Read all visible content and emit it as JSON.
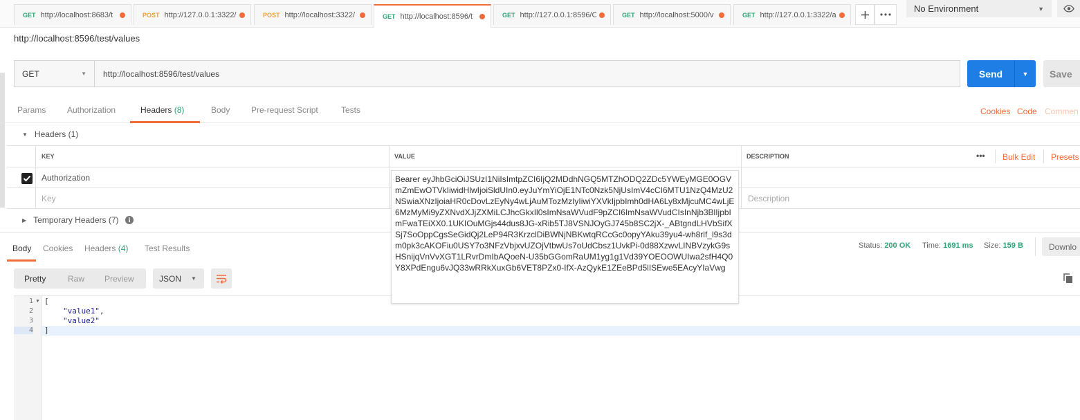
{
  "tabs": [
    {
      "method": "GET",
      "url": "http://localhost:8683/t"
    },
    {
      "method": "POST",
      "url": "http://127.0.0.1:3322/"
    },
    {
      "method": "POST",
      "url": "http://localhost:3322/"
    },
    {
      "method": "GET",
      "url": "http://localhost:8596/t"
    },
    {
      "method": "GET",
      "url": "http://127.0.0.1:8596/C"
    },
    {
      "method": "GET",
      "url": "http://localhost:5000/v"
    },
    {
      "method": "GET",
      "url": "http://127.0.0.1:3322/a"
    }
  ],
  "environment": "No Environment",
  "request": {
    "title": "http://localhost:8596/test/values",
    "method": "GET",
    "url": "http://localhost:8596/test/values",
    "send_label": "Send",
    "save_label": "Save"
  },
  "request_tabs": {
    "params": "Params",
    "authorization": "Authorization",
    "headers": "Headers",
    "headers_count": "(8)",
    "body": "Body",
    "prerequest": "Pre-request Script",
    "tests": "Tests",
    "cookies": "Cookies",
    "code": "Code",
    "comments": "Commen"
  },
  "headers_section": {
    "title": "Headers",
    "count": "(1)",
    "col_key": "KEY",
    "col_value": "VALUE",
    "col_description": "DESCRIPTION",
    "more": "•••",
    "bulk_edit": "Bulk Edit",
    "presets": "Presets",
    "row_key": "Authorization",
    "key_placeholder": "Key",
    "description_placeholder": "Description",
    "token": "Bearer eyJhbGciOiJSUzI1NiIsImtpZCI6IjQ2MDdhNGQ5MTZhODQ2ZDc5YWEyMGE0OGVmZmEwOTVkIiwidHlwIjoiSldUIn0.eyJuYmYiOjE1NTc0Nzk5NjUsImV4cCI6MTU1NzQ4MzU2NSwiaXNzIjoiaHR0cDovLzEyNy4wLjAuMTozMzIyIiwiYXVkIjpbImh0dHA6Ly8xMjcuMC4wLjE6MzMyMi9yZXNvdXJjZXMiLCJhcGkxIl0sImNsaWVudF9pZCI6ImNsaWVudCIsInNjb3BlIjpbImFwaTEiXX0.1UKIOuMGjs44dus8JG-xRib5TJ8VSNJOyGJ745b8SC2jX-_ABtgndLHVbSifXSj7SoOppCgsSeGidQj2LeP94R3KrzclDiBWNjNBKwtqRCcGc0opyYAku39yu4-wh8rlf_l9s3dm0pk3cAKOFiu0USY7o3NFzVbjxvUZOjVtbwUs7oUdCbsz1UvkPi-0d88XzwvLINBVzykG9sHSnijqVnVvXGT1LRvrDmIbAQoeN-U35bGGomRaUM1yg1g1Vd39YOEOOWUIwa2sfH4Q0Y8XPdEngu6vJQ33wRRkXuxGb6VET8PZx0-IfX-AzQykE1ZEeBPd5lISEwe5EAcyYIaVwg"
  },
  "temp_headers": {
    "title": "Temporary Headers",
    "count": "(7)"
  },
  "response": {
    "tabs": {
      "body": "Body",
      "cookies": "Cookies",
      "headers": "Headers",
      "headers_count": "(4)",
      "tests": "Test Results"
    },
    "status_label": "Status:",
    "status": "200 OK",
    "time_label": "Time:",
    "time": "1691 ms",
    "size_label": "Size:",
    "size": "159 B",
    "download": "Downlo",
    "views": {
      "pretty": "Pretty",
      "raw": "Raw",
      "preview": "Preview"
    },
    "format": "JSON",
    "lines": [
      "1",
      "2",
      "3",
      "4"
    ],
    "code": {
      "open": "[",
      "v1": "\"value1\"",
      "comma": ",",
      "v2": "\"value2\"",
      "close": "]"
    }
  },
  "colors": {
    "accent": "#f26b3a",
    "send": "#1f7de6",
    "get": "#2fa577",
    "post": "#f0a22e"
  }
}
